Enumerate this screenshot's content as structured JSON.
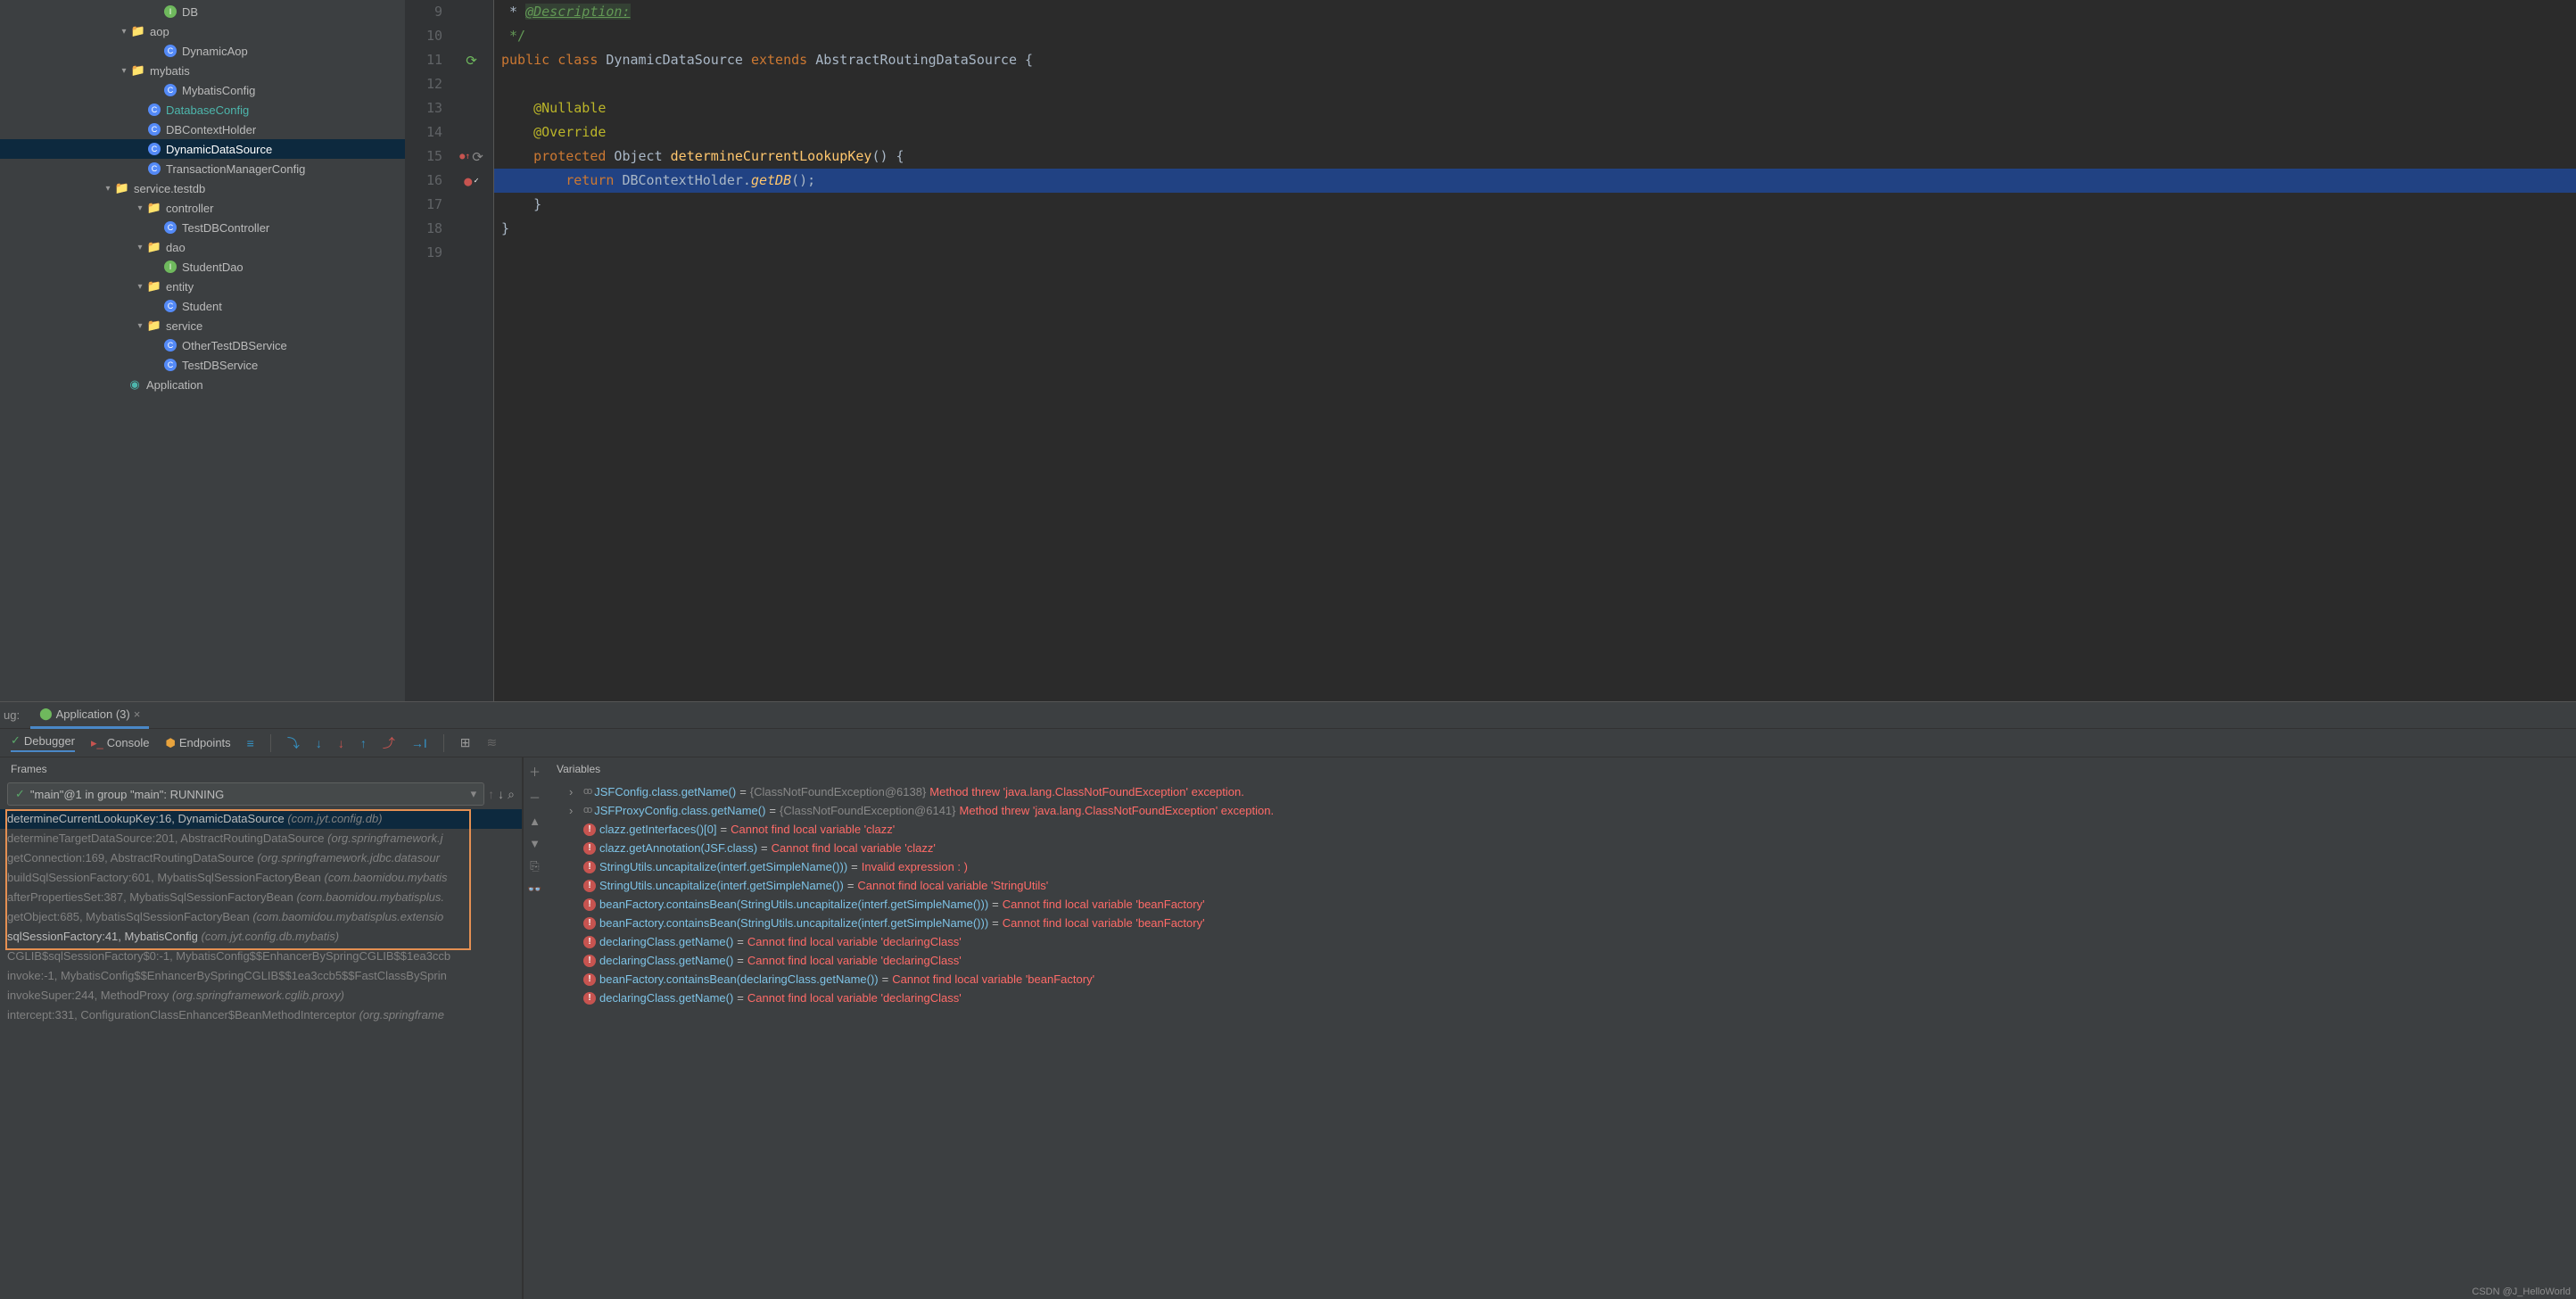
{
  "tree": [
    {
      "pad": 168,
      "chev": "",
      "icon": "interface",
      "label": "DB"
    },
    {
      "pad": 132,
      "chev": "▾",
      "icon": "folder",
      "label": "aop"
    },
    {
      "pad": 168,
      "chev": "",
      "icon": "class",
      "label": "DynamicAop"
    },
    {
      "pad": 132,
      "chev": "▾",
      "icon": "folder",
      "label": "mybatis"
    },
    {
      "pad": 168,
      "chev": "",
      "icon": "class",
      "label": "MybatisConfig"
    },
    {
      "pad": 150,
      "chev": "",
      "icon": "class",
      "label": "DatabaseConfig",
      "teal": true
    },
    {
      "pad": 150,
      "chev": "",
      "icon": "class",
      "label": "DBContextHolder"
    },
    {
      "pad": 150,
      "chev": "",
      "icon": "class",
      "label": "DynamicDataSource",
      "sel": true
    },
    {
      "pad": 150,
      "chev": "",
      "icon": "class",
      "label": "TransactionManagerConfig"
    },
    {
      "pad": 114,
      "chev": "▾",
      "icon": "folder",
      "label": "service.testdb"
    },
    {
      "pad": 150,
      "chev": "▾",
      "icon": "folder",
      "label": "controller"
    },
    {
      "pad": 168,
      "chev": "",
      "icon": "class",
      "label": "TestDBController"
    },
    {
      "pad": 150,
      "chev": "▾",
      "icon": "folder",
      "label": "dao"
    },
    {
      "pad": 168,
      "chev": "",
      "icon": "interface",
      "label": "StudentDao"
    },
    {
      "pad": 150,
      "chev": "▾",
      "icon": "folder",
      "label": "entity"
    },
    {
      "pad": 168,
      "chev": "",
      "icon": "class",
      "label": "Student"
    },
    {
      "pad": 150,
      "chev": "▾",
      "icon": "folder",
      "label": "service"
    },
    {
      "pad": 168,
      "chev": "",
      "icon": "class",
      "label": "OtherTestDBService"
    },
    {
      "pad": 168,
      "chev": "",
      "icon": "class",
      "label": "TestDBService"
    },
    {
      "pad": 128,
      "chev": "",
      "icon": "teal",
      "label": "Application"
    }
  ],
  "code": {
    "lines": [
      {
        "n": 9,
        "html": " * <span class='doc-tag'>@Description:</span>"
      },
      {
        "n": 10,
        "html": " */",
        "cls": "comment"
      },
      {
        "n": 11,
        "html": "<span class='kw'>public class</span> DynamicDataSource <span class='kw'>extends</span> AbstractRoutingDataSource {",
        "gutter": "impl"
      },
      {
        "n": 12,
        "html": ""
      },
      {
        "n": 13,
        "html": "    <span class='ann'>@Nullable</span>"
      },
      {
        "n": 14,
        "html": "    <span class='ann'>@Override</span>"
      },
      {
        "n": 15,
        "html": "    <span class='kw'>protected</span> Object <span class='type'>determineCurrentLookupKey</span>() {",
        "gutter": "override"
      },
      {
        "n": 16,
        "html": "        <span class='kw'>return</span> DBContextHolder.<span class='method-call'>getDB</span>();",
        "hl": true,
        "gutter": "bp"
      },
      {
        "n": 17,
        "html": "    }"
      },
      {
        "n": 18,
        "html": "}"
      },
      {
        "n": 19,
        "html": ""
      }
    ]
  },
  "debug": {
    "label": "ug:",
    "tab": "Application (3)",
    "toolbar": {
      "debugger": "Debugger",
      "console": "Console",
      "endpoints": "Endpoints"
    },
    "frames_header": "Frames",
    "thread": "\"main\"@1 in group \"main\": RUNNING",
    "frames": [
      {
        "m": "determineCurrentLookupKey:16, DynamicDataSource",
        "p": "(com.jyt.config.db)",
        "sel": true,
        "own": true
      },
      {
        "m": "determineTargetDataSource:201, AbstractRoutingDataSource",
        "p": "(org.springframework.j"
      },
      {
        "m": "getConnection:169, AbstractRoutingDataSource",
        "p": "(org.springframework.jdbc.datasour"
      },
      {
        "m": "buildSqlSessionFactory:601, MybatisSqlSessionFactoryBean",
        "p": "(com.baomidou.mybatis"
      },
      {
        "m": "afterPropertiesSet:387, MybatisSqlSessionFactoryBean",
        "p": "(com.baomidou.mybatisplus."
      },
      {
        "m": "getObject:685, MybatisSqlSessionFactoryBean",
        "p": "(com.baomidou.mybatisplus.extensio"
      },
      {
        "m": "sqlSessionFactory:41, MybatisConfig",
        "p": "(com.jyt.config.db.mybatis)",
        "own": true
      },
      {
        "m": "CGLIB$sqlSessionFactory$0:-1, MybatisConfig$$EnhancerBySpringCGLIB$$1ea3ccb",
        "p": ""
      },
      {
        "m": "invoke:-1, MybatisConfig$$EnhancerBySpringCGLIB$$1ea3ccb5$$FastClassBySprin",
        "p": ""
      },
      {
        "m": "invokeSuper:244, MethodProxy",
        "p": "(org.springframework.cglib.proxy)"
      },
      {
        "m": "intercept:331, ConfigurationClassEnhancer$BeanMethodInterceptor",
        "p": "(org.springframe"
      }
    ],
    "vars_header": "Variables",
    "vars": [
      {
        "chev": "›",
        "ic": "oo",
        "expr": "JSFConfig.class.getName()",
        "eq": " = ",
        "obj": "{ClassNotFoundException@6138}",
        "err": " Method threw 'java.lang.ClassNotFoundException' exception."
      },
      {
        "chev": "›",
        "ic": "oo",
        "expr": "JSFProxyConfig.class.getName()",
        "eq": " = ",
        "obj": "{ClassNotFoundException@6141}",
        "err": " Method threw 'java.lang.ClassNotFoundException' exception."
      },
      {
        "ic": "err",
        "expr": "clazz.getInterfaces()[0]",
        "eq": " = ",
        "err": "Cannot find local variable 'clazz'"
      },
      {
        "ic": "err",
        "expr": "clazz.getAnnotation(JSF.class)",
        "eq": " = ",
        "err": "Cannot find local variable 'clazz'"
      },
      {
        "ic": "err",
        "expr": "StringUtils.uncapitalize(interf.getSimpleName()))",
        "eq": " = ",
        "err": "Invalid expression : )"
      },
      {
        "ic": "err",
        "expr": "StringUtils.uncapitalize(interf.getSimpleName())",
        "eq": " = ",
        "err": "Cannot find local variable 'StringUtils'"
      },
      {
        "ic": "err",
        "expr": "beanFactory.containsBean(StringUtils.uncapitalize(interf.getSimpleName()))",
        "eq": " = ",
        "err": "Cannot find local variable 'beanFactory'"
      },
      {
        "ic": "err",
        "expr": "beanFactory.containsBean(StringUtils.uncapitalize(interf.getSimpleName()))",
        "eq": " = ",
        "err": "Cannot find local variable 'beanFactory'"
      },
      {
        "ic": "err",
        "expr": "declaringClass.getName()",
        "eq": " = ",
        "err": "Cannot find local variable 'declaringClass'"
      },
      {
        "ic": "err",
        "expr": "declaringClass.getName()",
        "eq": " = ",
        "err": "Cannot find local variable 'declaringClass'"
      },
      {
        "ic": "err",
        "expr": "beanFactory.containsBean(declaringClass.getName())",
        "eq": " = ",
        "err": "Cannot find local variable 'beanFactory'"
      },
      {
        "ic": "err",
        "expr": "declaringClass.getName()",
        "eq": " = ",
        "err": "Cannot find local variable 'declaringClass'"
      }
    ]
  },
  "watermark": "CSDN @J_HelloWorld"
}
